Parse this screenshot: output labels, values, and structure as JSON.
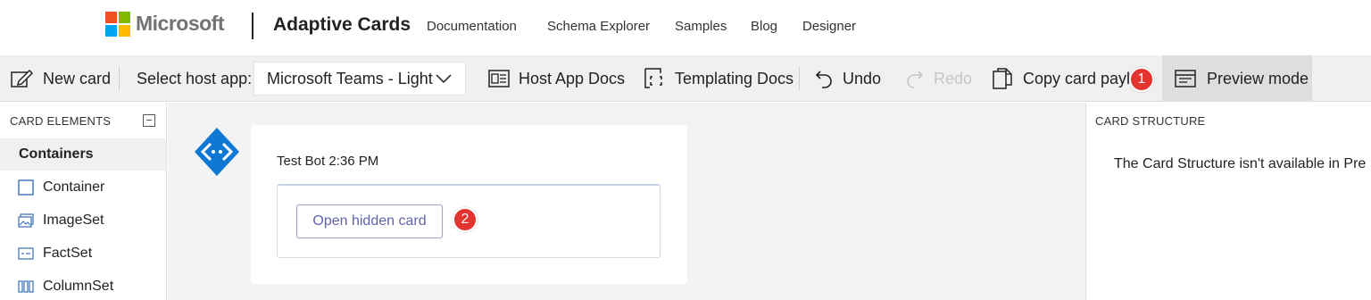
{
  "nav": {
    "brand": "Microsoft",
    "title": "Adaptive Cards",
    "links": [
      "Documentation",
      "Schema Explorer",
      "Samples",
      "Blog",
      "Designer"
    ]
  },
  "toolbar": {
    "new_card": "New card",
    "select_host_label": "Select host app:",
    "host_app_value": "Microsoft Teams - Light",
    "host_app_docs": "Host App Docs",
    "templating_docs": "Templating Docs",
    "undo": "Undo",
    "redo": "Redo",
    "copy_payload": "Copy card paylo",
    "preview_mode": "Preview mode"
  },
  "markers": {
    "first": "1",
    "second": "2"
  },
  "left_panel": {
    "title": "CARD ELEMENTS",
    "category": "Containers",
    "items": [
      "Container",
      "ImageSet",
      "FactSet",
      "ColumnSet"
    ]
  },
  "card": {
    "sender": "Test Bot 2:36 PM",
    "button": "Open hidden card"
  },
  "right_panel": {
    "title": "CARD STRUCTURE",
    "message": "The Card Structure isn't available in Pre"
  },
  "colors": {
    "ms_red": "#f25022",
    "ms_green": "#7fba00",
    "ms_blue": "#00a4ef",
    "ms_yellow": "#ffb900",
    "bot_blue": "#0f78d4",
    "teams_purple": "#6264a7",
    "marker_red": "#e3342f"
  },
  "icons": [
    "edit-icon",
    "chevron-down-icon",
    "docs-icon",
    "template-icon",
    "undo-icon",
    "redo-icon",
    "copy-icon",
    "preview-icon",
    "collapse-icon",
    "container-icon",
    "imageset-icon",
    "factset-icon",
    "columnset-icon",
    "bot-avatar-icon"
  ]
}
